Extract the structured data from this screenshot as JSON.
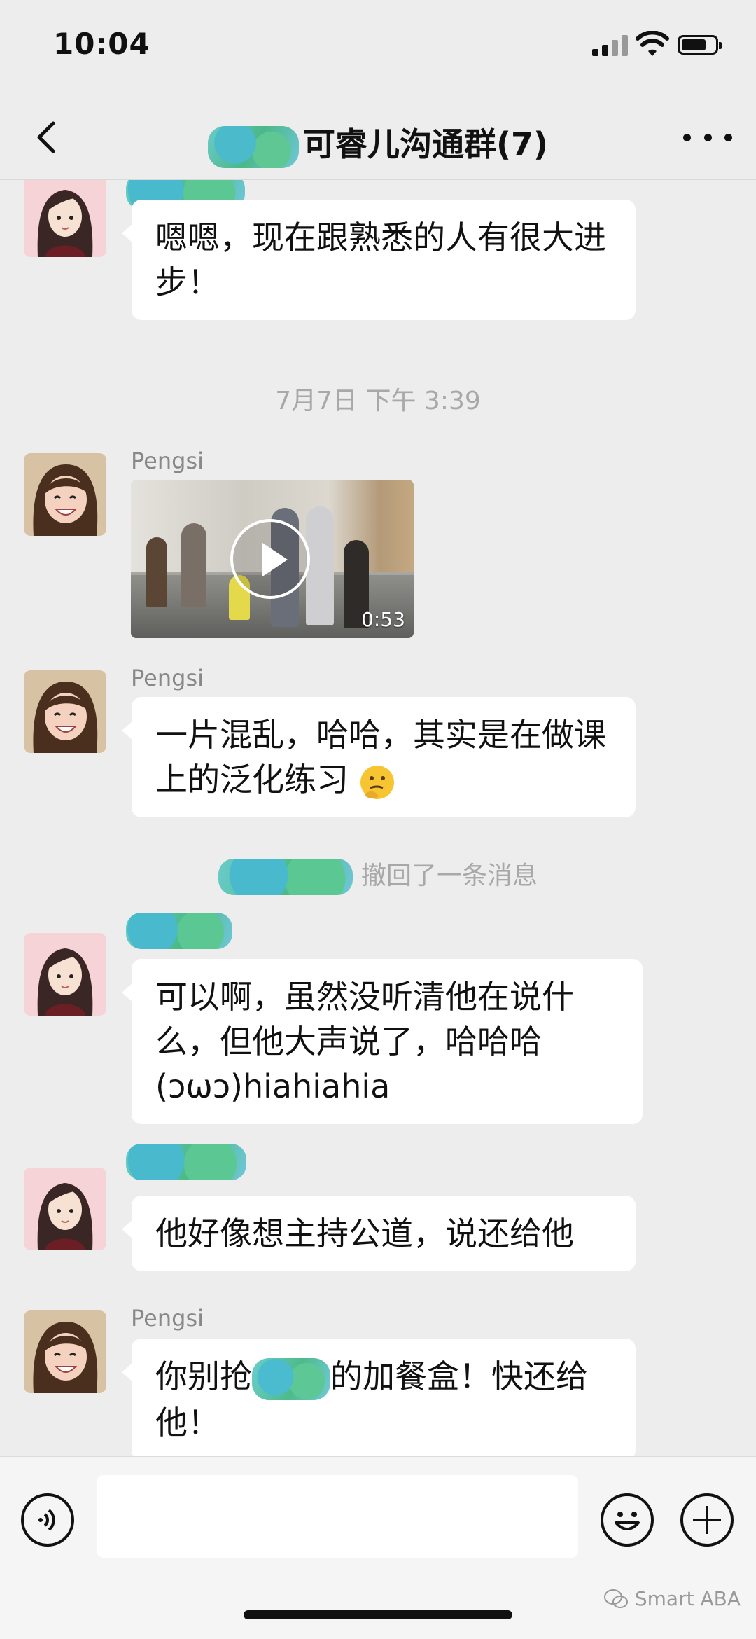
{
  "status_bar": {
    "time": "10:04"
  },
  "nav": {
    "title": "可睿儿沟通群(7)"
  },
  "chat": {
    "messages": {
      "m1": {
        "text": "嗯嗯，现在跟熟悉的人有很大进步！"
      },
      "time_separator": "7月7日 下午 3:39",
      "m2": {
        "sender": "Pengsi",
        "video_duration": "0:53"
      },
      "m3": {
        "sender": "Pengsi",
        "text": "一片混乱，哈哈，其实是在做课上的泛化练习"
      },
      "recall_text": "撤回了一条消息",
      "m4": {
        "text": "可以啊，虽然没听清他在说什么，但他大声说了，哈哈哈 (ↄωↄ)hiahiahia"
      },
      "m5": {
        "text": "他好像想主持公道，说还给他"
      },
      "m6": {
        "sender": "Pengsi",
        "text_before": "你别抢",
        "text_after": "的加餐盒！快还给他！"
      }
    }
  },
  "watermark": "Smart ABA",
  "icons": [
    "back-arrow-icon",
    "more-dots-icon",
    "voice-icon",
    "emoji-icon",
    "plus-icon",
    "play-icon",
    "signal-icon",
    "wifi-icon",
    "battery-icon"
  ],
  "colors": {
    "background": "#ededed",
    "bubble": "#ffffff",
    "meta_text": "#a8a8a8",
    "redaction": "#3ab47d"
  }
}
